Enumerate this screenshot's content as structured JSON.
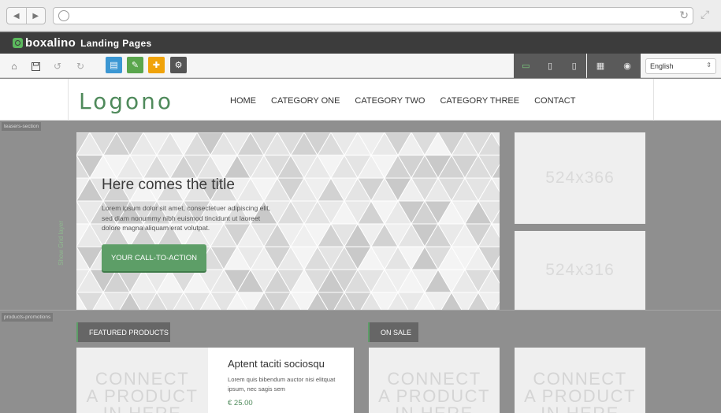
{
  "app": {
    "brand_name": "boxalino",
    "brand_subtitle": "Landing Pages"
  },
  "toolbar": {
    "language": "English",
    "icons": [
      "home-icon",
      "save-icon",
      "undo-icon",
      "redo-icon",
      "layout-icon",
      "edit-icon",
      "add-icon",
      "settings-icon"
    ],
    "device_icons": [
      "desktop-icon",
      "tablet-icon",
      "mobile-icon"
    ],
    "view_icons": [
      "grid-icon",
      "preview-icon"
    ],
    "colors": {
      "layout": "#3b97d3",
      "edit": "#5aa64d",
      "add": "#f0a30a",
      "settings": "#555555",
      "active_device": "#7dd17f"
    }
  },
  "site": {
    "logo": "Logono",
    "menu": [
      "HOME",
      "CATEGORY ONE",
      "CATEGORY TWO",
      "CATEGORY THREE",
      "CONTACT"
    ]
  },
  "sections": {
    "teasers_tag": "teasers-section",
    "products_tag": "products-promotions",
    "vertical_label": "Show Grid layer"
  },
  "hero": {
    "title": "Here comes the title",
    "text": "Lorem ipsum dolor sit amet, consectetuer adipiscing elit, sed diam nonummy nibh euismod tincidunt ut laoreet dolore magna aliquam erat volutpat.",
    "cta": "YOUR CALL-TO-ACTION"
  },
  "placeholders": {
    "top": "524x366",
    "bottom": "524x316"
  },
  "featured": {
    "tab": "FEATURED PRODUCTS",
    "connect": [
      "CONNECT",
      "A PRODUCT",
      "IN HERE"
    ],
    "product_title": "Aptent taciti sociosqu",
    "product_text": "Lorem quis bibendum auctor nisi elitquat ipsum, nec sagis sem",
    "product_price": "€ 25.00"
  },
  "on_sale": {
    "tab": "ON SALE",
    "connect": [
      "CONNECT",
      "A PRODUCT",
      "IN HERE"
    ]
  }
}
